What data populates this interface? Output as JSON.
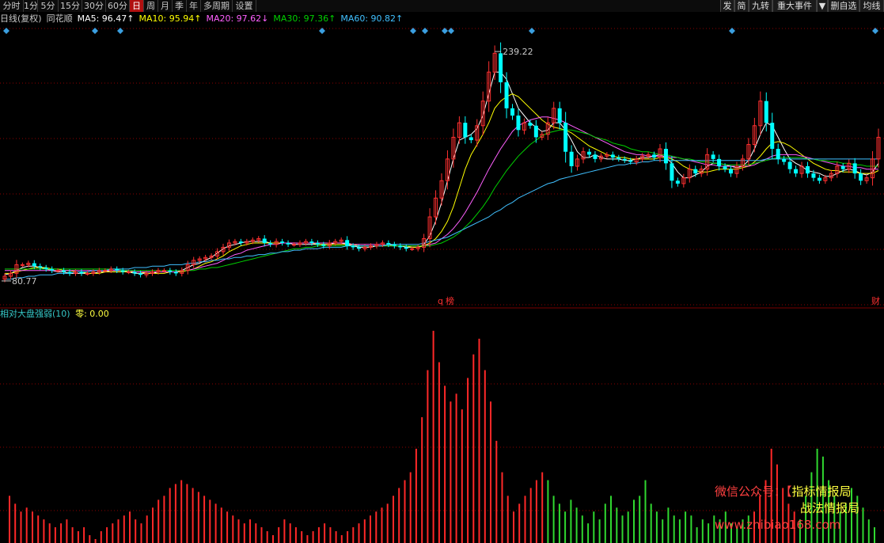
{
  "toolbar": {
    "periods": [
      "分时",
      "1分",
      "5分",
      "15分",
      "30分",
      "60分",
      "日",
      "周",
      "月",
      "季",
      "年",
      "多周期",
      "设置"
    ],
    "active": "日",
    "right_buttons": [
      "发",
      "简",
      "九转",
      "重大事件",
      "▼",
      "删自选",
      "均线"
    ]
  },
  "legend": {
    "chart_label": "日线(复权)",
    "stock": "同花顺",
    "ma": [
      {
        "label": "MA5: 96.47↑",
        "color": "#ffffff"
      },
      {
        "label": "MA10: 95.94↑",
        "color": "#ffff00"
      },
      {
        "label": "MA20: 97.62↓",
        "color": "#ff60ff"
      },
      {
        "label": "MA30: 97.36↑",
        "color": "#00d000"
      },
      {
        "label": "MA60: 90.82↑",
        "color": "#40c0ff"
      }
    ]
  },
  "price": {
    "high_label": "239.22",
    "low_label": "80.77",
    "event_q": "q",
    "event_mark": "榜",
    "event_right": "财"
  },
  "indicator": {
    "name": "相对大盘强弱(10)",
    "value_label": "零: 0.00"
  },
  "watermark": {
    "line1": "微信公众号：",
    "bracket": "【",
    "line1b": "指标情报局",
    "line2b": "战法情报局",
    "line3": "www.zhibiao168.com"
  },
  "colors": {
    "up": "#ff3030",
    "down": "#00ffff",
    "bar_up": "#ff2828",
    "bar_down": "#30d830",
    "grid": "#8b0000",
    "diamond": "#3b9fe0"
  },
  "chart_data": [
    {
      "type": "candlestick",
      "title": "日线(复权) 同花顺",
      "yhigh": 239.22,
      "ylow": 80.77,
      "close": [
        84,
        86,
        92,
        92,
        93,
        91,
        90,
        89,
        88,
        88,
        87,
        86,
        87,
        86,
        86,
        87,
        88,
        88,
        89,
        88,
        87,
        87,
        86,
        85,
        86,
        87,
        88,
        88,
        87,
        86,
        88,
        92,
        95,
        96,
        97,
        98,
        101,
        104,
        107,
        108,
        107,
        108,
        109,
        110,
        107,
        106,
        108,
        107,
        106,
        106,
        107,
        108,
        107,
        106,
        105,
        107,
        108,
        109,
        105,
        104,
        103,
        104,
        105,
        106,
        107,
        106,
        105,
        104,
        103,
        103,
        104,
        110,
        125,
        138,
        150,
        165,
        180,
        190,
        180,
        178,
        188,
        205,
        225,
        238,
        218,
        200,
        195,
        185,
        190,
        188,
        180,
        182,
        190,
        200,
        190,
        170,
        160,
        165,
        170,
        168,
        165,
        167,
        168,
        166,
        165,
        164,
        163,
        165,
        167,
        168,
        166,
        172,
        162,
        150,
        148,
        152,
        158,
        155,
        158,
        168,
        165,
        160,
        158,
        155,
        160,
        165,
        175,
        188,
        205,
        190,
        172,
        165,
        163,
        158,
        155,
        160,
        155,
        152,
        150,
        152,
        155,
        160,
        158,
        162,
        155,
        150,
        152,
        165,
        180
      ],
      "ma": {
        "MA5": [
          85,
          86,
          88,
          90,
          91,
          91,
          90,
          89,
          88,
          87,
          87,
          86,
          86,
          86,
          86,
          86,
          87,
          87,
          88,
          88,
          88,
          87,
          86,
          86,
          86,
          86,
          87,
          87,
          87,
          87,
          88,
          90,
          92,
          93,
          95,
          97,
          100,
          103,
          105,
          106,
          107,
          108,
          108,
          108,
          108,
          107,
          107,
          107,
          107,
          106,
          106,
          106,
          106,
          106,
          106,
          106,
          107,
          107,
          106,
          105,
          104,
          104,
          104,
          105,
          105,
          106,
          105,
          105,
          104,
          104,
          104,
          106,
          112,
          122,
          135,
          150,
          165,
          178,
          180,
          182,
          186,
          195,
          210,
          225,
          225,
          220,
          210,
          200,
          195,
          190,
          187,
          184,
          185,
          190,
          190,
          185,
          178,
          170,
          166,
          166,
          168,
          166,
          165,
          165,
          165,
          164,
          164,
          165,
          166,
          166,
          167,
          168,
          166,
          162,
          156,
          152,
          152,
          154,
          156,
          160,
          162,
          162,
          161,
          160,
          159,
          160,
          164,
          172,
          182,
          190,
          188,
          180,
          172,
          165,
          162,
          160,
          157,
          156,
          155,
          153,
          153,
          155,
          157,
          158,
          157,
          155,
          154,
          156,
          162
        ],
        "MA10": [
          86,
          86,
          87,
          88,
          89,
          90,
          90,
          90,
          89,
          89,
          88,
          88,
          87,
          87,
          86,
          86,
          86,
          87,
          87,
          87,
          87,
          87,
          87,
          87,
          86,
          86,
          86,
          86,
          87,
          87,
          87,
          88,
          89,
          91,
          93,
          94,
          96,
          98,
          101,
          103,
          105,
          106,
          107,
          107,
          107,
          107,
          107,
          107,
          107,
          107,
          107,
          107,
          107,
          106,
          106,
          106,
          106,
          106,
          106,
          106,
          105,
          105,
          105,
          105,
          105,
          105,
          105,
          105,
          105,
          104,
          104,
          105,
          107,
          110,
          115,
          122,
          132,
          145,
          158,
          168,
          175,
          182,
          190,
          200,
          205,
          208,
          210,
          208,
          204,
          200,
          196,
          192,
          189,
          187,
          186,
          185,
          183,
          180,
          177,
          174,
          172,
          170,
          168,
          167,
          166,
          166,
          165,
          165,
          165,
          165,
          165,
          166,
          166,
          165,
          163,
          160,
          158,
          157,
          156,
          156,
          157,
          158,
          158,
          158,
          158,
          159,
          160,
          163,
          167,
          172,
          176,
          177,
          176,
          174,
          171,
          168,
          165,
          162,
          160,
          158,
          157,
          157,
          156,
          156,
          156,
          155,
          155,
          155,
          157
        ],
        "MA20": [
          88,
          88,
          88,
          88,
          88,
          88,
          88,
          88,
          88,
          88,
          88,
          88,
          88,
          88,
          88,
          88,
          88,
          88,
          88,
          88,
          88,
          88,
          87,
          87,
          87,
          87,
          87,
          87,
          87,
          87,
          88,
          88,
          89,
          90,
          91,
          92,
          93,
          95,
          97,
          99,
          100,
          102,
          103,
          104,
          105,
          106,
          106,
          107,
          107,
          107,
          107,
          107,
          107,
          107,
          107,
          107,
          107,
          107,
          107,
          106,
          106,
          106,
          106,
          106,
          106,
          105,
          105,
          105,
          105,
          105,
          105,
          105,
          106,
          107,
          110,
          113,
          117,
          122,
          128,
          135,
          142,
          150,
          158,
          165,
          172,
          178,
          184,
          188,
          190,
          192,
          193,
          194,
          194,
          193,
          192,
          190,
          188,
          186,
          184,
          182,
          180,
          178,
          176,
          174,
          172,
          170,
          169,
          168,
          168,
          167,
          167,
          167,
          167,
          166,
          166,
          165,
          164,
          163,
          162,
          161,
          161,
          160,
          160,
          160,
          160,
          160,
          160,
          161,
          163,
          165,
          167,
          168,
          168,
          168,
          168,
          167,
          166,
          165,
          164,
          163,
          162,
          161,
          160,
          160,
          159,
          159,
          158,
          158,
          158
        ],
        "MA30": [
          89,
          89,
          89,
          89,
          89,
          89,
          89,
          89,
          89,
          89,
          89,
          89,
          89,
          89,
          89,
          89,
          89,
          89,
          89,
          89,
          88,
          88,
          88,
          88,
          88,
          88,
          88,
          88,
          88,
          88,
          88,
          88,
          88,
          89,
          89,
          90,
          90,
          91,
          92,
          93,
          94,
          95,
          96,
          97,
          98,
          99,
          100,
          101,
          102,
          103,
          103,
          104,
          104,
          105,
          105,
          105,
          105,
          105,
          105,
          105,
          105,
          105,
          105,
          105,
          105,
          105,
          105,
          105,
          105,
          105,
          105,
          105,
          105,
          106,
          107,
          109,
          111,
          114,
          118,
          122,
          127,
          132,
          138,
          145,
          151,
          157,
          162,
          167,
          171,
          175,
          178,
          181,
          183,
          184,
          185,
          185,
          185,
          184,
          183,
          182,
          180,
          179,
          178,
          176,
          175,
          174,
          172,
          171,
          170,
          170,
          169,
          168,
          168,
          167,
          166,
          165,
          165,
          164,
          163,
          163,
          162,
          162,
          161,
          161,
          161,
          161,
          161,
          162,
          163,
          164,
          165,
          166,
          166,
          166,
          166,
          166,
          165,
          165,
          164,
          164,
          163,
          163,
          162,
          162,
          161,
          161,
          160,
          160,
          160
        ],
        "MA60": [
          82,
          82,
          83,
          83,
          84,
          84,
          85,
          85,
          85,
          86,
          86,
          86,
          87,
          87,
          87,
          88,
          88,
          88,
          89,
          89,
          89,
          89,
          90,
          90,
          90,
          91,
          91,
          91,
          92,
          92,
          92,
          93,
          93,
          94,
          94,
          95,
          95,
          96,
          96,
          97,
          97,
          98,
          98,
          99,
          99,
          100,
          100,
          101,
          101,
          102,
          102,
          103,
          103,
          103,
          104,
          104,
          104,
          104,
          105,
          105,
          105,
          105,
          105,
          105,
          105,
          106,
          106,
          106,
          106,
          106,
          106,
          107,
          108,
          109,
          110,
          111,
          113,
          115,
          117,
          119,
          121,
          123,
          125,
          128,
          130,
          133,
          135,
          138,
          140,
          142,
          144,
          146,
          148,
          149,
          151,
          152,
          153,
          154,
          155,
          156,
          157,
          158,
          159,
          160,
          161,
          161,
          162,
          162,
          163,
          163,
          164,
          164,
          164,
          164,
          164,
          164,
          164,
          164,
          164,
          164,
          164,
          164,
          164,
          164,
          164,
          164,
          164,
          164,
          164,
          165,
          165,
          165,
          165,
          165,
          165,
          165,
          165,
          165,
          165,
          165,
          165,
          165,
          165,
          165,
          165,
          165,
          165,
          165,
          165
        ]
      }
    },
    {
      "type": "bar",
      "title": "相对大盘强弱(10)",
      "zero_label": "零: 0.00",
      "values": [
        60,
        50,
        40,
        45,
        40,
        35,
        30,
        25,
        20,
        25,
        30,
        20,
        15,
        20,
        10,
        5,
        15,
        20,
        25,
        30,
        35,
        40,
        30,
        25,
        35,
        45,
        55,
        60,
        70,
        75,
        80,
        75,
        70,
        65,
        60,
        55,
        50,
        45,
        40,
        35,
        30,
        25,
        30,
        25,
        20,
        15,
        10,
        20,
        30,
        25,
        20,
        15,
        10,
        15,
        20,
        25,
        20,
        15,
        10,
        15,
        20,
        25,
        30,
        35,
        40,
        45,
        50,
        60,
        70,
        80,
        90,
        120,
        160,
        220,
        270,
        230,
        200,
        180,
        190,
        170,
        210,
        240,
        260,
        220,
        180,
        130,
        90,
        60,
        40,
        50,
        60,
        70,
        80,
        90,
        -80,
        -60,
        -50,
        -40,
        -55,
        -45,
        -35,
        -25,
        -40,
        -30,
        -50,
        -60,
        -45,
        -35,
        -40,
        -55,
        -60,
        -80,
        -50,
        -40,
        -30,
        -45,
        -35,
        -30,
        -40,
        -35,
        -20,
        -30,
        -25,
        -35,
        -30,
        -40,
        -25,
        -20,
        -30,
        -35,
        40,
        60,
        80,
        120,
        100,
        70,
        50,
        40,
        -30,
        -60,
        -90,
        -120,
        -110,
        -80,
        -60,
        -40,
        -50,
        -70,
        -60,
        -45,
        -30,
        -20
      ]
    }
  ]
}
